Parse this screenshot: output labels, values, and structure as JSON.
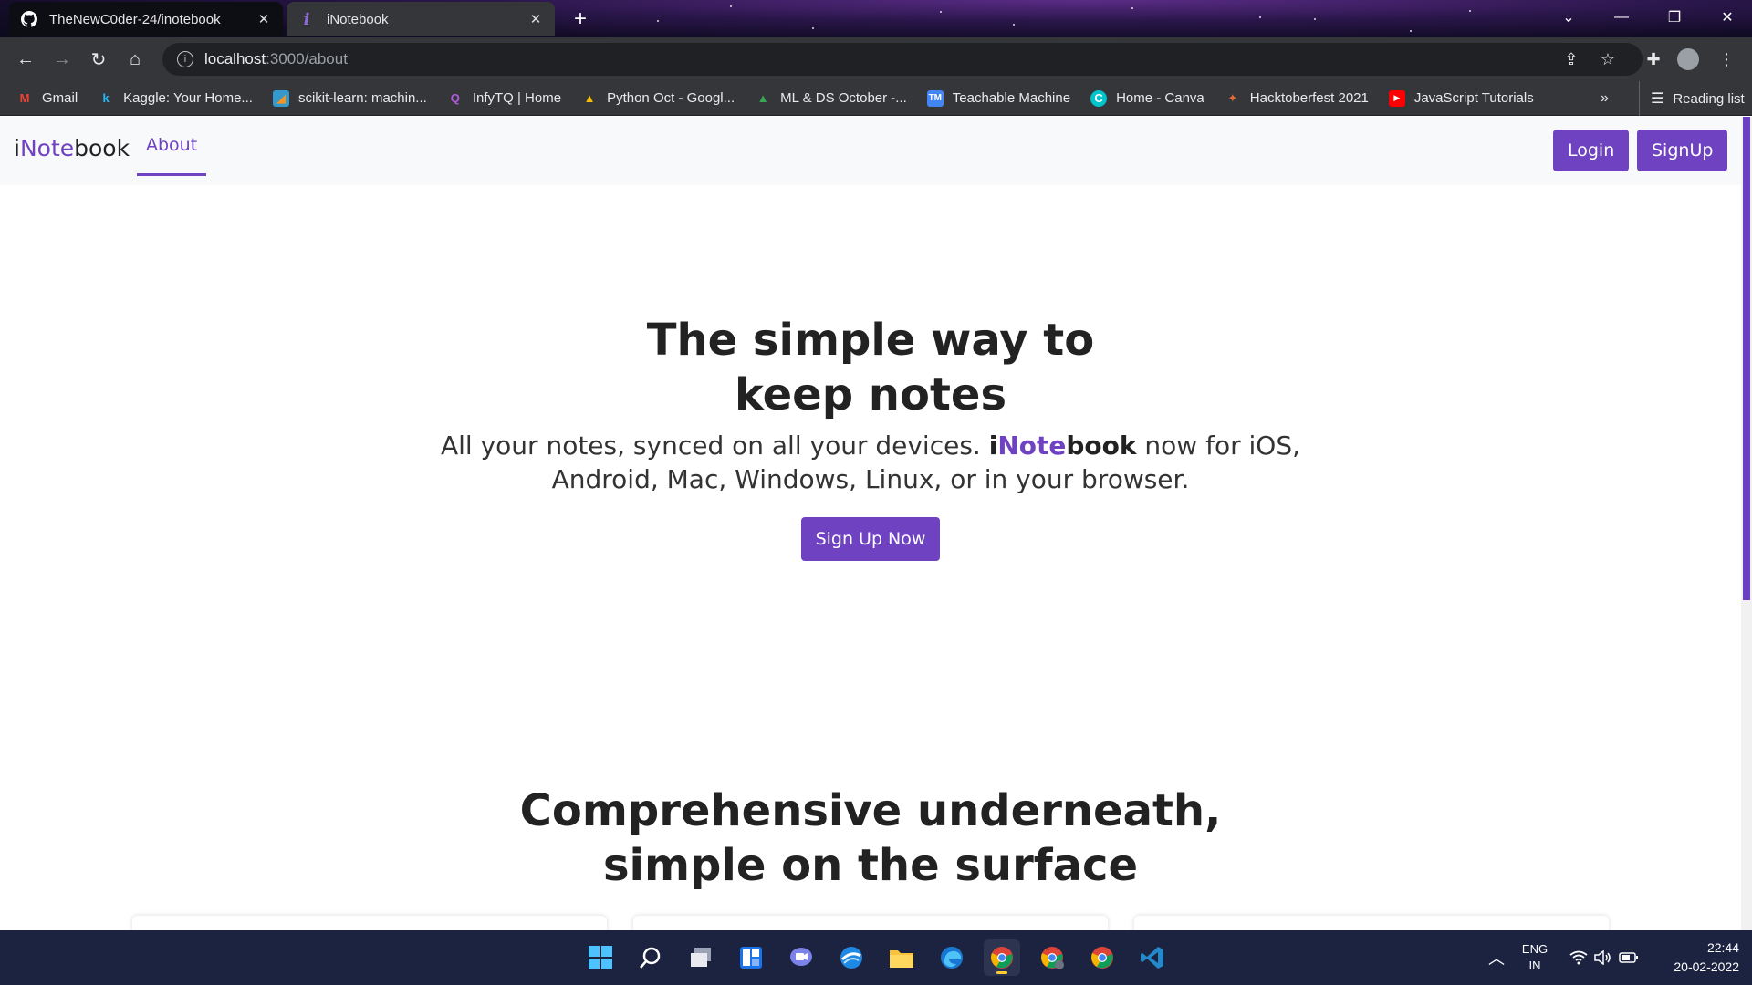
{
  "browser": {
    "tabs": [
      {
        "title": "TheNewC0der-24/inotebook",
        "favicon": "github-icon",
        "active": false
      },
      {
        "title": "iNotebook",
        "favicon": "inotebook-i-icon",
        "active": true
      }
    ],
    "address": {
      "host": "localhost",
      "path": ":3000/about"
    },
    "bookmarks": [
      {
        "label": "Gmail",
        "icon": "gmail-icon",
        "glyph": "M",
        "color": "#ea4335"
      },
      {
        "label": "Kaggle: Your Home...",
        "icon": "kaggle-icon",
        "glyph": "k",
        "color": "#20beff"
      },
      {
        "label": "scikit-learn: machin...",
        "icon": "sklearn-icon",
        "glyph": "◢",
        "color": "#f7931e"
      },
      {
        "label": "InfyTQ | Home",
        "icon": "infytq-icon",
        "glyph": "Q",
        "color": "#8e44ad"
      },
      {
        "label": "Python Oct - Googl...",
        "icon": "google-drive-icon",
        "glyph": "▲",
        "color": "#fbbc04"
      },
      {
        "label": "ML & DS October -...",
        "icon": "google-drive-icon",
        "glyph": "▲",
        "color": "#34a853"
      },
      {
        "label": "Teachable Machine",
        "icon": "teachable-machine-icon",
        "glyph": "TM",
        "color": "#4285f4"
      },
      {
        "label": "Home - Canva",
        "icon": "canva-icon",
        "glyph": "C",
        "color": "#00c4cc"
      },
      {
        "label": "Hacktoberfest 2021",
        "icon": "hacktoberfest-icon",
        "glyph": "✦",
        "color": "#e86a3a"
      },
      {
        "label": "JavaScript Tutorials",
        "icon": "youtube-icon",
        "glyph": "▶",
        "color": "#ff0000"
      }
    ],
    "more": "»",
    "reading_list": "Reading list"
  },
  "navbar": {
    "brand_prefix": "i",
    "brand_accent": "Note",
    "brand_suffix": "book",
    "about": "About",
    "login": "Login",
    "signup": "SignUp"
  },
  "hero": {
    "title_line1": "The simple way to",
    "title_line2": "keep notes",
    "sub_part1": "All your notes, synced on all your devices. ",
    "sub_brand_prefix": "i",
    "sub_brand_accent": "Note",
    "sub_brand_suffix": "book",
    "sub_part2": " now for iOS,",
    "sub_line2": "Android, Mac, Windows, Linux, or in your browser.",
    "cta": "Sign Up Now"
  },
  "features": {
    "title_line1": "Comprehensive underneath,",
    "title_line2": "simple on the surface"
  },
  "colors": {
    "accent": "#6f42c1",
    "navbar_bg": "#f8f9fa",
    "taskbar_bg": "#1c2340"
  },
  "taskbar": {
    "apps": [
      "windows-start-icon",
      "search-icon",
      "task-view-icon",
      "widgets-icon",
      "teams-chat-icon",
      "browser-icon",
      "file-explorer-icon",
      "edge-icon",
      "chrome-icon",
      "chrome-profile-icon",
      "chrome-icon",
      "vscode-icon"
    ],
    "lang_line1": "ENG",
    "lang_line2": "IN",
    "time": "22:44",
    "date": "20-02-2022"
  }
}
